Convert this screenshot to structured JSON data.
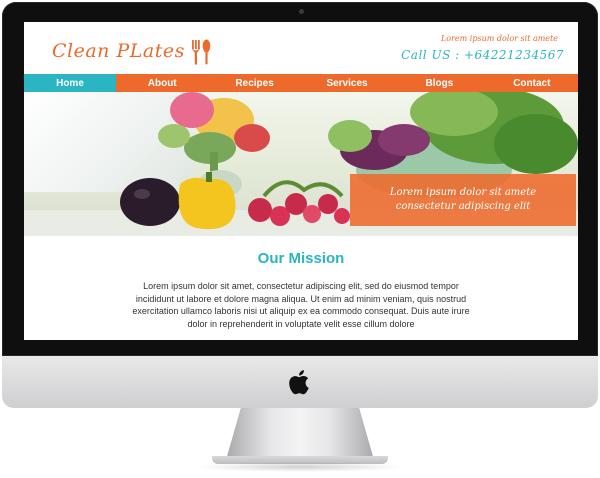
{
  "site": {
    "brand": "Clean PLates",
    "tagline": "Lorem ipsum dolor sit amete",
    "call_us": "Call US : +64221234567"
  },
  "nav": {
    "items": [
      {
        "label": "Home",
        "active": true
      },
      {
        "label": "About"
      },
      {
        "label": "Recipes"
      },
      {
        "label": "Services"
      },
      {
        "label": "Blogs"
      },
      {
        "label": "Contact"
      }
    ]
  },
  "hero": {
    "caption_line1": "Lorem ipsum dolor sit amete",
    "caption_line2": "consectetur adipiscing elit"
  },
  "mission": {
    "title": "Our Mission",
    "text": "Lorem ipsum dolor sit amet, consectetur adipiscing elit, sed do eiusmod tempor incididunt ut labore et dolore magna aliqua. Ut enim ad minim veniam, quis nostrud exercitation ullamco laboris nisi ut aliquip ex ea commodo consequat. Duis aute irure dolor in reprehenderit in voluptate velit esse cillum dolore"
  },
  "colors": {
    "accent_orange": "#ee6a2c",
    "accent_teal": "#2bb5c3"
  },
  "icons": {
    "logo": "fork-spoon-icon",
    "device_logo": "apple-logo-icon"
  }
}
